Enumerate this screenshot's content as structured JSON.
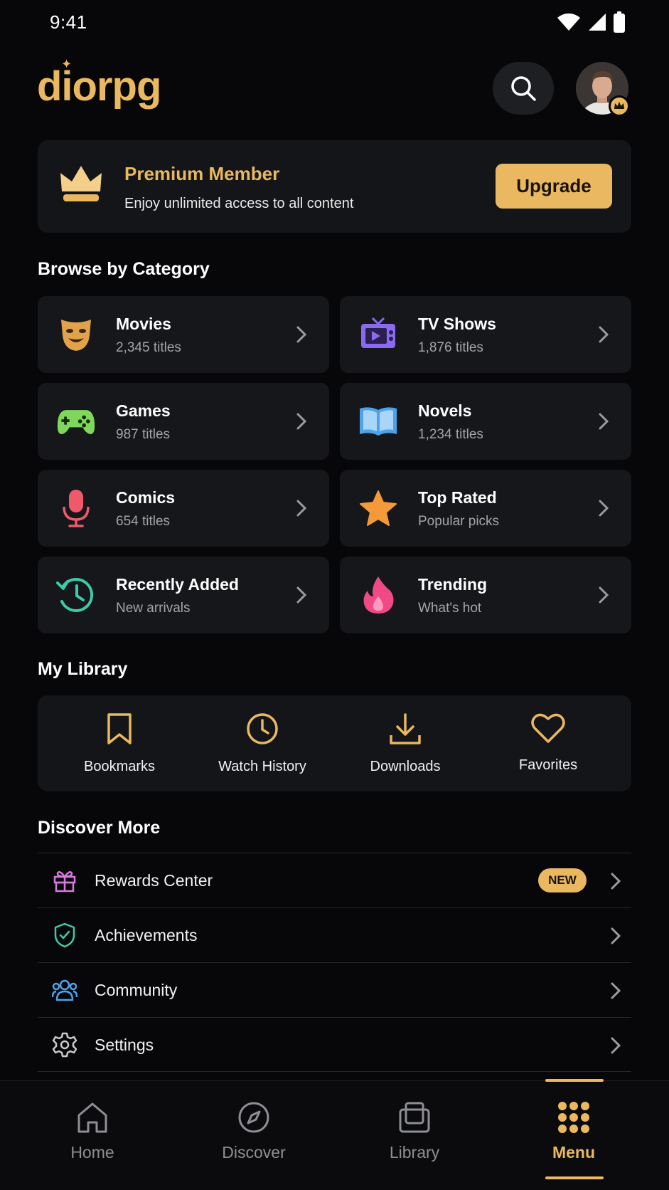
{
  "status": {
    "time": "9:41"
  },
  "app": {
    "logo": "diorpg"
  },
  "premium": {
    "title": "Premium Member",
    "subtitle": "Enjoy unlimited access to all content",
    "upgrade_label": "Upgrade"
  },
  "categories_title": "Browse by Category",
  "categories": [
    {
      "name": "Movies",
      "count": "2,345 titles",
      "icon": "theater-mask-icon",
      "color": "#e0a24a"
    },
    {
      "name": "TV Shows",
      "count": "1,876 titles",
      "icon": "tv-icon",
      "color": "#8a6af0"
    },
    {
      "name": "Games",
      "count": "987 titles",
      "icon": "gamepad-icon",
      "color": "#7fd85a"
    },
    {
      "name": "Novels",
      "count": "1,234 titles",
      "icon": "book-icon",
      "color": "#4ea3e8"
    },
    {
      "name": "Comics",
      "count": "654 titles",
      "icon": "microphone-icon",
      "color": "#f0596a"
    },
    {
      "name": "Top Rated",
      "count": "Popular picks",
      "icon": "star-icon",
      "color": "#f59a3a"
    },
    {
      "name": "Recently Added",
      "count": "New arrivals",
      "icon": "history-icon",
      "color": "#3ec9a8"
    },
    {
      "name": "Trending",
      "count": "What's hot",
      "icon": "flame-icon",
      "color": "#f04a84"
    }
  ],
  "library_title": "My Library",
  "library": [
    {
      "label": "Bookmarks",
      "icon": "bookmark-icon"
    },
    {
      "label": "Watch History",
      "icon": "clock-icon"
    },
    {
      "label": "Downloads",
      "icon": "download-icon"
    },
    {
      "label": "Favorites",
      "icon": "heart-icon"
    }
  ],
  "discover_title": "Discover More",
  "discover": [
    {
      "label": "Rewards Center",
      "icon": "gift-icon",
      "badge": "NEW"
    },
    {
      "label": "Achievements",
      "icon": "shield-check-icon"
    },
    {
      "label": "Community",
      "icon": "users-icon"
    },
    {
      "label": "Settings",
      "icon": "gear-icon"
    }
  ],
  "nav": [
    {
      "label": "Home",
      "icon": "home-icon"
    },
    {
      "label": "Discover",
      "icon": "compass-icon"
    },
    {
      "label": "Library",
      "icon": "library-icon"
    },
    {
      "label": "Menu",
      "icon": "grid-icon",
      "active": true
    }
  ],
  "colors": {
    "accent": "#e9b860",
    "background": "#070709",
    "card": "#16171a"
  }
}
